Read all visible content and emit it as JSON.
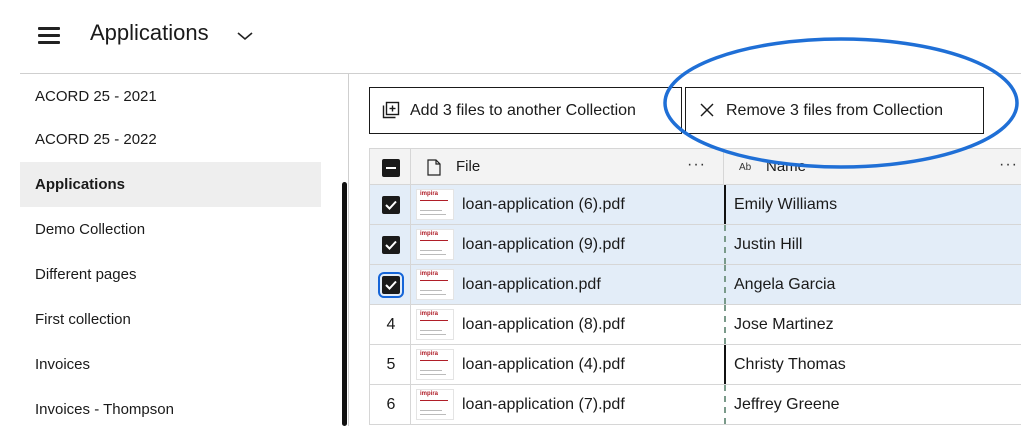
{
  "header": {
    "title": "Applications"
  },
  "sidebar": {
    "items": [
      {
        "label": "ACORD 25 - 2021",
        "active": false
      },
      {
        "label": "ACORD 25 - 2022",
        "active": false
      },
      {
        "label": "Applications",
        "active": true
      },
      {
        "label": "Demo Collection",
        "active": false
      },
      {
        "label": "Different pages",
        "active": false
      },
      {
        "label": "First collection",
        "active": false
      },
      {
        "label": "Invoices",
        "active": false
      },
      {
        "label": "Invoices - Thompson",
        "active": false
      }
    ]
  },
  "toolbar": {
    "add_label": "Add 3 files to another Collection",
    "remove_label": "Remove 3 files from Collection"
  },
  "table": {
    "columns": {
      "file": "File",
      "name_type": "Ab",
      "name": "Name",
      "menu": "···"
    },
    "thumb_logo": "impira",
    "rows": [
      {
        "num": "",
        "selected": true,
        "file": "loan-application (6).pdf",
        "name": "Emily Williams"
      },
      {
        "num": "",
        "selected": true,
        "file": "loan-application (9).pdf",
        "name": "Justin Hill"
      },
      {
        "num": "",
        "selected": true,
        "file": "loan-application.pdf",
        "name": "Angela Garcia"
      },
      {
        "num": "4",
        "selected": false,
        "file": "loan-application (8).pdf",
        "name": "Jose Martinez"
      },
      {
        "num": "5",
        "selected": false,
        "file": "loan-application (4).pdf",
        "name": "Christy Thomas"
      },
      {
        "num": "6",
        "selected": false,
        "file": "loan-application (7).pdf",
        "name": "Jeffrey Greene"
      }
    ]
  },
  "colors": {
    "selected_row": "#e3edf8",
    "annotation": "#1f6fd6",
    "focus": "#1565d8"
  }
}
